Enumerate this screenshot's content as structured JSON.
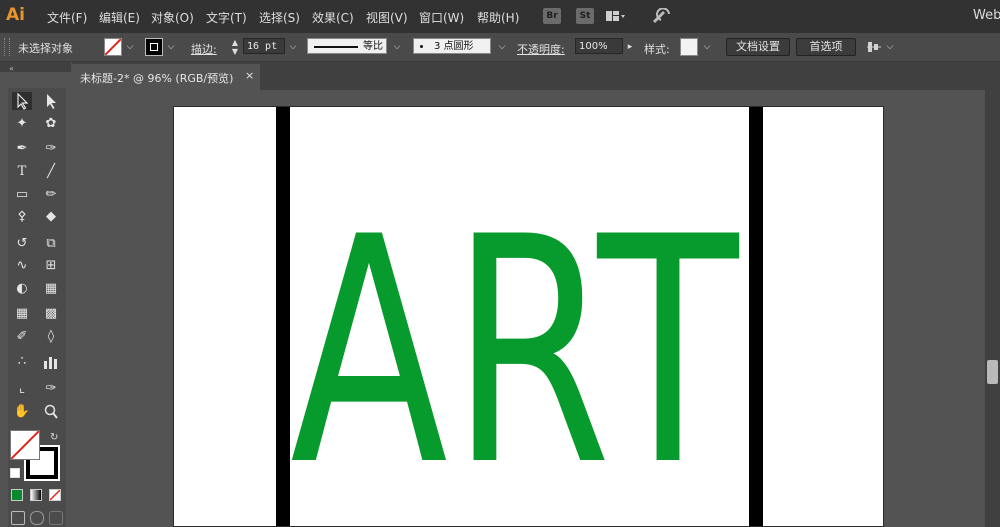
{
  "app": {
    "logo": "Ai",
    "workspace": "Web"
  },
  "menubar": {
    "items": [
      "文件(F)",
      "编辑(E)",
      "对象(O)",
      "文字(T)",
      "选择(S)",
      "效果(C)",
      "视图(V)",
      "窗口(W)",
      "帮助(H)"
    ],
    "badges": [
      "Br",
      "St"
    ]
  },
  "controlbar": {
    "selection_status": "未选择对象",
    "stroke_label": "描边:",
    "stroke_weight": "16 pt",
    "stroke_profile": "等比",
    "brush": "3 点圆形",
    "opacity_label": "不透明度:",
    "opacity_value": "100%",
    "style_label": "样式:",
    "doc_setup_button": "文档设置",
    "preferences_button": "首选项"
  },
  "document": {
    "tab_title": "未标题-2* @ 96% (RGB/预览)",
    "tab_close": "×",
    "artwork_text": "ART",
    "artwork_color": "#079a2c"
  },
  "colors": {
    "menubar_bg": "#323232",
    "panel_bg": "#535353",
    "logo": "#e8952f",
    "fill_green": "#0a8a2e"
  },
  "tools": {
    "icons": [
      "selection-icon",
      "direct-selection-icon",
      "magic-wand-icon",
      "lasso-icon",
      "pen-icon",
      "curvature-icon",
      "type-icon",
      "line-icon",
      "rectangle-icon",
      "paintbrush-icon",
      "shaper-icon",
      "eraser-icon",
      "rotate-icon",
      "scale-icon",
      "width-icon",
      "free-transform-icon",
      "shape-builder-icon",
      "perspective-icon",
      "mesh-icon",
      "gradient-icon",
      "eyedropper-icon",
      "blend-icon",
      "symbol-sprayer-icon",
      "column-graph-icon",
      "artboard-icon",
      "slice-icon",
      "hand-icon",
      "zoom-icon"
    ]
  }
}
